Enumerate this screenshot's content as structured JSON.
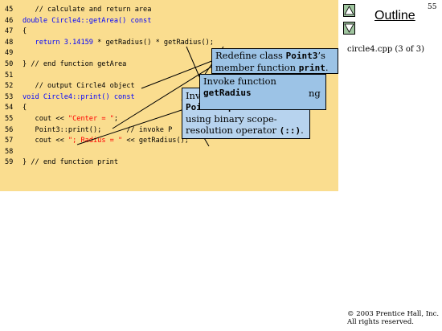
{
  "slide": {
    "page_number": "55",
    "outline_label": "Outline",
    "file_label": "circle4.cpp (3 of 3)",
    "copyright_line1": "© 2003 Prentice Hall, Inc.",
    "copyright_line2": "All rights reserved."
  },
  "nav": {
    "up_icon": "triangle-up-icon",
    "down_icon": "triangle-down-icon"
  },
  "code_lines": [
    {
      "num": "45",
      "segments": [
        {
          "t": "   // calculate and return area",
          "c": "cm"
        }
      ]
    },
    {
      "num": "46",
      "segments": [
        {
          "t": "double Circle4::getArea() const",
          "c": "kw"
        }
      ]
    },
    {
      "num": "47",
      "segments": [
        {
          "t": "{",
          "c": "tx"
        }
      ]
    },
    {
      "num": "48",
      "segments": [
        {
          "t": "   return ",
          "c": "kw"
        },
        {
          "t": "3.14159",
          "c": "lit"
        },
        {
          "t": " * getRadius() * getRadius();",
          "c": "tx"
        }
      ]
    },
    {
      "num": "49",
      "segments": [
        {
          "t": "",
          "c": "tx"
        }
      ]
    },
    {
      "num": "50",
      "segments": [
        {
          "t": "} // end function getArea",
          "c": "cm"
        }
      ]
    },
    {
      "num": "51",
      "segments": [
        {
          "t": "",
          "c": "tx"
        }
      ]
    },
    {
      "num": "52",
      "segments": [
        {
          "t": "   // output Circle4 object",
          "c": "cm"
        }
      ]
    },
    {
      "num": "53",
      "segments": [
        {
          "t": "void Circle4::print() const",
          "c": "kw"
        }
      ]
    },
    {
      "num": "54",
      "segments": [
        {
          "t": "{",
          "c": "tx"
        }
      ]
    },
    {
      "num": "55",
      "segments": [
        {
          "t": "   cout << ",
          "c": "tx"
        },
        {
          "t": "\"Center = \"",
          "c": "st"
        },
        {
          "t": ";",
          "c": "tx"
        }
      ]
    },
    {
      "num": "56",
      "segments": [
        {
          "t": "   Point3::print();      ",
          "c": "tx"
        },
        {
          "t": "// invoke P",
          "c": "cm"
        }
      ]
    },
    {
      "num": "57",
      "segments": [
        {
          "t": "   cout << ",
          "c": "tx"
        },
        {
          "t": "\"; Radius = \"",
          "c": "st"
        },
        {
          "t": " << getRadius();",
          "c": "tx"
        }
      ]
    },
    {
      "num": "58",
      "segments": [
        {
          "t": "",
          "c": "tx"
        }
      ]
    },
    {
      "num": "59",
      "segments": [
        {
          "t": "} // end function print",
          "c": "cm"
        }
      ]
    }
  ],
  "callouts": {
    "redefine": {
      "pre": "Redefine class ",
      "code1": "Point3",
      "mid": "’s member function ",
      "code2": "print",
      "post": "."
    },
    "get_radius": {
      "pre": "Invoke function ",
      "code1": "getRadius",
      "overflow": "ng"
    },
    "base_print": {
      "pre": "Invoke base-class ",
      "code1": "Point3",
      "mid": "’s ",
      "code2": "print",
      "mid2": " function using binary scope-resolution operator ",
      "code3": "(::)",
      "post": "."
    }
  }
}
